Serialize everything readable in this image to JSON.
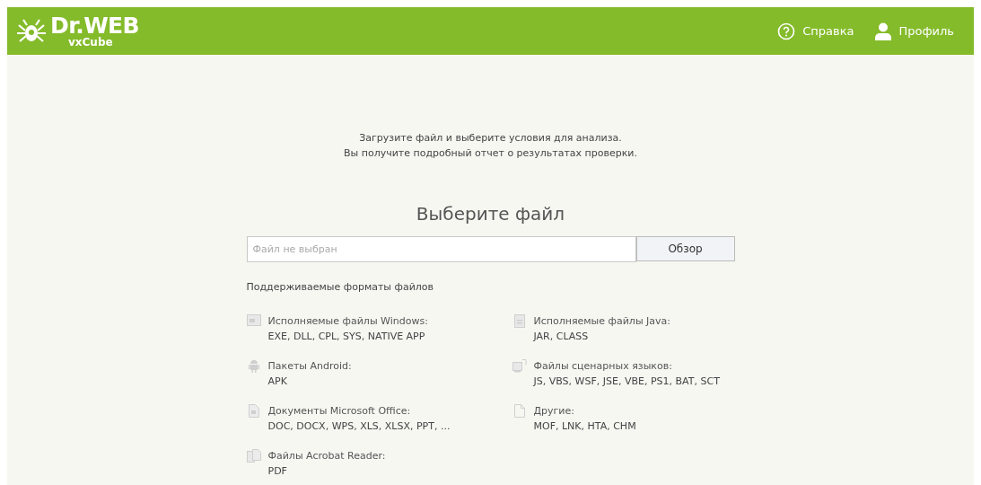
{
  "header": {
    "logo": "Dr.WEB",
    "product": "vxCube",
    "nav": [
      {
        "kind": "help",
        "label": "Справка"
      },
      {
        "kind": "profile",
        "label": "Профиль"
      }
    ]
  },
  "intro": [
    "Загрузите файл и выберите условия для анализа.",
    "Вы получите подробный отчет о результатах проверки."
  ],
  "title": "Выберите файл",
  "file_field": {
    "placeholder": "Файл не выбран"
  },
  "browse_button": "Обзор",
  "formats_heading": "Поддерживаемые форматы файлов",
  "formats": [
    {
      "kind": "windows",
      "name": "Исполняемые файлы Windows:",
      "types": "EXE, DLL, CPL, SYS, NATIVE APP"
    },
    {
      "kind": "java",
      "name": "Исполняемые файлы Java:",
      "types": "JAR, CLASS"
    },
    {
      "kind": "android",
      "name": "Пакеты Android:",
      "types": "APK"
    },
    {
      "kind": "script",
      "name": "Файлы сценарных языков:",
      "types": "JS, VBS, WSF, JSE, VBE, PS1, BAT, SCT"
    },
    {
      "kind": "office",
      "name": "Документы Microsoft Office:",
      "types": "DOC, DOCX, WPS, XLS, XLSX, PPT, ..."
    },
    {
      "kind": "other",
      "name": "Другие:",
      "types": "MOF, LNK, HTA, CHM"
    },
    {
      "kind": "acrobat",
      "name": "Файлы Acrobat Reader:",
      "types": "PDF"
    }
  ]
}
